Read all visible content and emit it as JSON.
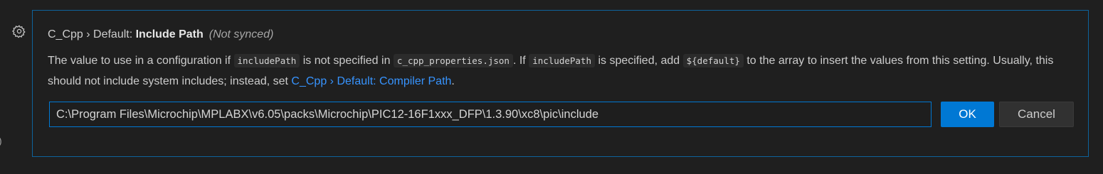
{
  "setting": {
    "category": "C_Cpp › Default: ",
    "label": "Include Path",
    "modified_indicator": "(Not synced)",
    "description": {
      "part1": "The value to use in a configuration if ",
      "code1": "includePath",
      "part2": " is not specified in ",
      "code2": "c_cpp_properties.json",
      "part3": ". If ",
      "code3": "includePath",
      "part4": " is specified, add ",
      "code4": "${default}",
      "part5": " to the array to insert the values from this setting. Usually, this should not include system includes; instead, set ",
      "link": "C_Cpp › Default: Compiler Path",
      "part6": "."
    },
    "input_value": "C:\\Program Files\\Microchip\\MPLABX\\v6.05\\packs\\Microchip\\PIC12-16F1xxx_DFP\\1.3.90\\xc8\\pic\\include"
  },
  "buttons": {
    "ok_label": "OK",
    "cancel_label": "Cancel"
  },
  "left_gutter_glyph": ")",
  "icons": {
    "settings_gear": "gear-icon"
  },
  "colors": {
    "focus_border": "#0e639c",
    "primary_button": "#0078d4",
    "link": "#3794ff",
    "background": "#1f1f1f"
  }
}
